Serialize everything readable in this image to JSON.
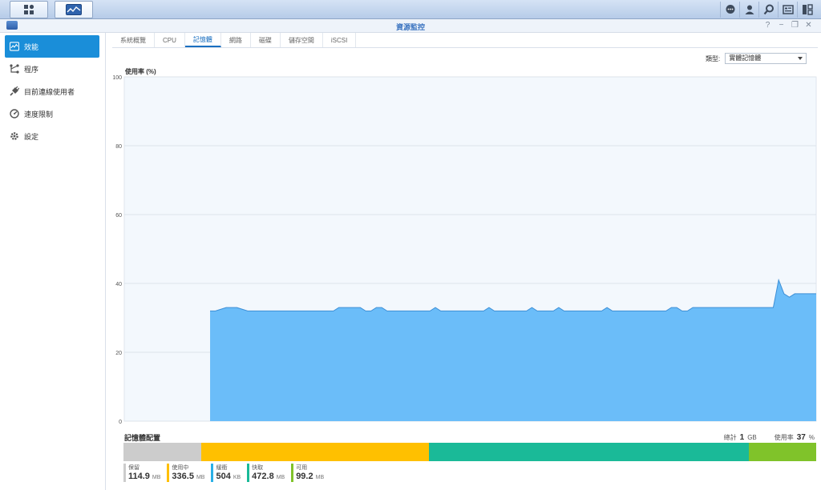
{
  "window": {
    "title": "資源監控"
  },
  "taskbar": {
    "buttons": [
      "main-menu",
      "resource-monitor"
    ],
    "right_icons": [
      "chat-icon",
      "user-icon",
      "search-icon",
      "widget-icon",
      "layout-icon"
    ]
  },
  "window_controls": {
    "help": "?",
    "minimize": "−",
    "restore": "❐",
    "close": "✕"
  },
  "sidebar": {
    "items": [
      {
        "label": "效能",
        "icon": "performance-icon",
        "active": true
      },
      {
        "label": "程序",
        "icon": "process-icon",
        "active": false
      },
      {
        "label": "目前連線使用者",
        "icon": "plug-icon",
        "active": false
      },
      {
        "label": "速度限制",
        "icon": "speed-gauge-icon",
        "active": false
      },
      {
        "label": "設定",
        "icon": "gear-icon",
        "active": false
      }
    ]
  },
  "tabs": [
    {
      "label": "系統概覽",
      "active": false
    },
    {
      "label": "CPU",
      "active": false
    },
    {
      "label": "記憶體",
      "active": true
    },
    {
      "label": "網路",
      "active": false
    },
    {
      "label": "磁碟",
      "active": false
    },
    {
      "label": "儲存空間",
      "active": false
    },
    {
      "label": "iSCSI",
      "active": false
    }
  ],
  "type_selector": {
    "label": "類型:",
    "value": "實體記憶體"
  },
  "chart_data": {
    "type": "area",
    "title": "",
    "ylabel": "使用率 (%)",
    "xlabel": "",
    "ylim": [
      0,
      100
    ],
    "yticks": [
      0,
      20,
      40,
      60,
      80,
      100
    ],
    "grid": true,
    "x": [
      0,
      16,
      17,
      19,
      21,
      23,
      24,
      26,
      27,
      39,
      40,
      42,
      44,
      45,
      46,
      47,
      48,
      49,
      50,
      51,
      57,
      58,
      59,
      67,
      68,
      69,
      75,
      76,
      77,
      79,
      80,
      81,
      82,
      83,
      84,
      89,
      90,
      91,
      92,
      93,
      101,
      102,
      103,
      104,
      105,
      106,
      107,
      108,
      109,
      118,
      119,
      120,
      121,
      122,
      123,
      124,
      125,
      126,
      127,
      128,
      129
    ],
    "series": [
      {
        "values": [
          null,
          32,
          32,
          33,
          33,
          32,
          32,
          32,
          32,
          32,
          33,
          33,
          33,
          32,
          32,
          33,
          33,
          32,
          32,
          32,
          32,
          33,
          32,
          32,
          33,
          32,
          32,
          33,
          32,
          32,
          32,
          33,
          32,
          32,
          32,
          32,
          33,
          32,
          32,
          32,
          32,
          33,
          33,
          32,
          32,
          33,
          33,
          33,
          33,
          33,
          33,
          33,
          33,
          41,
          37,
          36,
          37,
          37,
          37,
          37,
          37
        ],
        "color": "#6bbdf9",
        "line_color": "#3c8ed6"
      }
    ]
  },
  "allocation": {
    "title": "記憶體配置",
    "total_label": "總計",
    "total_value": "1",
    "total_unit": "GB",
    "usage_label": "使用率",
    "usage_value": "37",
    "usage_unit": "%",
    "segments": [
      {
        "label": "保留",
        "value": "114.9",
        "unit": "MB",
        "mb": 114.9,
        "color": "#cccccc"
      },
      {
        "label": "使用中",
        "value": "336.5",
        "unit": "MB",
        "mb": 336.5,
        "color": "#ffc000"
      },
      {
        "label": "緩衝",
        "value": "504",
        "unit": "KB",
        "mb": 0.49,
        "color": "#2ab0e6"
      },
      {
        "label": "快取",
        "value": "472.8",
        "unit": "MB",
        "mb": 472.8,
        "color": "#1aba98"
      },
      {
        "label": "可用",
        "value": "99.2",
        "unit": "MB",
        "mb": 99.2,
        "color": "#80c32a"
      }
    ]
  }
}
